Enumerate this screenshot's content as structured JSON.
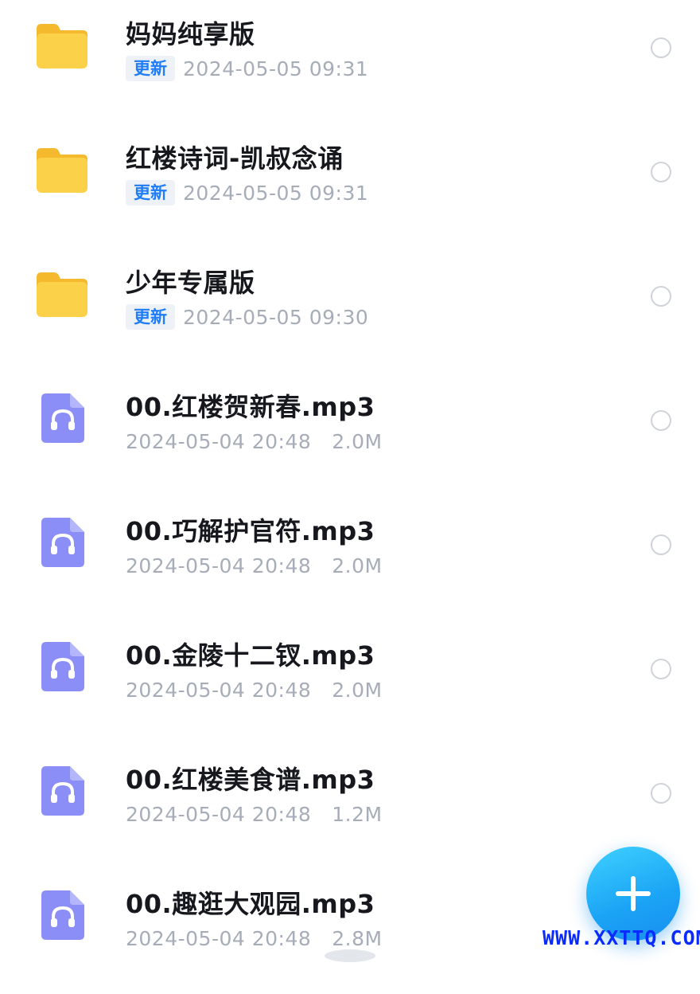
{
  "files": [
    {
      "type": "folder",
      "icon": "folder-icon",
      "name": "妈妈纯享版",
      "badge": "更新",
      "date": "2024-05-05 09:31",
      "size": ""
    },
    {
      "type": "folder",
      "icon": "folder-icon",
      "name": "红楼诗词-凯叔念诵",
      "badge": "更新",
      "date": "2024-05-05 09:31",
      "size": ""
    },
    {
      "type": "folder",
      "icon": "folder-icon",
      "name": "少年专属版",
      "badge": "更新",
      "date": "2024-05-05 09:30",
      "size": ""
    },
    {
      "type": "audio",
      "icon": "audio-file-icon",
      "name": "00.红楼贺新春.mp3",
      "badge": "",
      "date": "2024-05-04 20:48",
      "size": "2.0M"
    },
    {
      "type": "audio",
      "icon": "audio-file-icon",
      "name": "00.巧解护官符.mp3",
      "badge": "",
      "date": "2024-05-04 20:48",
      "size": "2.0M"
    },
    {
      "type": "audio",
      "icon": "audio-file-icon",
      "name": "00.金陵十二钗.mp3",
      "badge": "",
      "date": "2024-05-04 20:48",
      "size": "2.0M"
    },
    {
      "type": "audio",
      "icon": "audio-file-icon",
      "name": "00.红楼美食谱.mp3",
      "badge": "",
      "date": "2024-05-04 20:48",
      "size": "1.2M"
    },
    {
      "type": "audio",
      "icon": "audio-file-icon",
      "name": "00.趣逛大观园.mp3",
      "badge": "",
      "date": "2024-05-04 20:48",
      "size": "2.8M"
    }
  ],
  "fab": {
    "icon": "plus-icon"
  },
  "watermark": "WWW.XXTTQ.COM",
  "colors": {
    "folder": "#fcd14a",
    "audio_icon": "#8c8ef7",
    "badge_text": "#1f7df7",
    "badge_bg": "#eef2f7",
    "meta_text": "#a7adb8",
    "fab": "#1aa3f5",
    "watermark": "#0a2bff"
  }
}
